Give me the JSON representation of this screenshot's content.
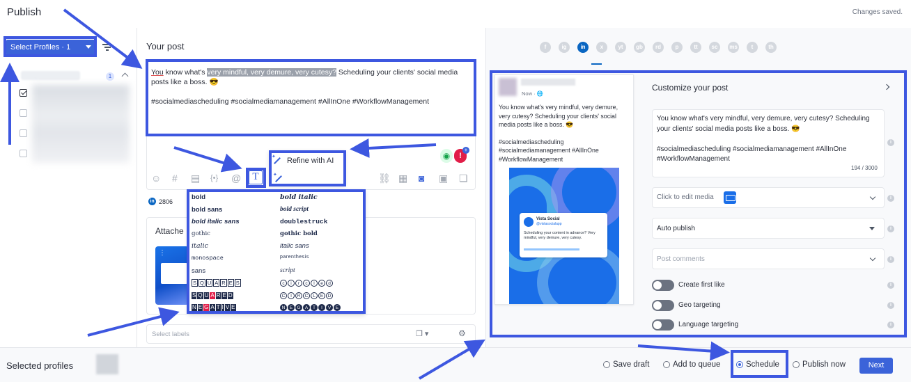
{
  "header": {
    "title": "Publish",
    "status": "Changes saved."
  },
  "sidebar": {
    "profile_select_label": "Select Profiles · 1",
    "group_count": "1"
  },
  "editor": {
    "heading": "Your post",
    "text_underlined": "You",
    "text_pre": " know what's ",
    "text_highlight": "very mindful, very demure, very cutesy?",
    "text_post": " Scheduling your clients' social media posts like a boss. 😎",
    "hashtags": "#socialmediascheduling #socialmediamanagement #AllInOne #WorkflowManagement",
    "refine_label": "Refine with AI",
    "text_format_label": "T",
    "linkedin_count": "2806",
    "attach_title": "Attache",
    "labels_placeholder": "Select labels"
  },
  "font_styles": [
    [
      "bold",
      "bold italic"
    ],
    [
      "bold sans",
      "bold script"
    ],
    [
      "bold italic sans",
      "doublestruck"
    ],
    [
      "gothic",
      "gothic bold"
    ],
    [
      "italic",
      "italic sans"
    ],
    [
      "monospace",
      "parenthesis"
    ],
    [
      "sans",
      "script"
    ],
    [
      "squares",
      "circled"
    ],
    [
      "SQUARED",
      "CIRCLED"
    ],
    [
      "NEGATIVE",
      "NEGATIVE"
    ]
  ],
  "networks": [
    "f",
    "ig",
    "in",
    "x",
    "yt",
    "gb",
    "rd",
    "p",
    "tt",
    "sc",
    "ms",
    "t",
    "th"
  ],
  "preview": {
    "time": "Now · 🌐",
    "text": "You know what's very mindful, very demure, very cutesy? Scheduling your clients' social media posts like a boss. 😎",
    "hashtags": "#socialmediascheduling #socialmediamanagement #AllInOne #WorkflowManagement",
    "embed_name": "Vista Social",
    "embed_handle": "@vistasocialapp",
    "embed_text": "Scheduling your content in advance? Very mindful, very demure, very cutesy."
  },
  "customize": {
    "title": "Customize your post",
    "text": "You know what's very mindful, very demure, very cutesy? Scheduling your clients' social media posts like a boss. 😎",
    "hashtags": "#socialmediascheduling #socialmediamanagement #AllInOne #WorkflowManagement",
    "char_count": "194 / 3000",
    "media_label": "Click to edit media",
    "publish_mode": "Auto publish",
    "comments_placeholder": "Post comments",
    "toggles": [
      "Create first like",
      "Geo targeting",
      "Language targeting"
    ]
  },
  "footer": {
    "selected_label": "Selected profiles",
    "options": [
      "Save draft",
      "Add to queue",
      "Schedule",
      "Publish now"
    ],
    "selected_option": "Schedule",
    "next_label": "Next"
  },
  "colors": {
    "accent": "#3b63d9",
    "annotation": "#3d57e0",
    "linkedin": "#0a66c2"
  }
}
